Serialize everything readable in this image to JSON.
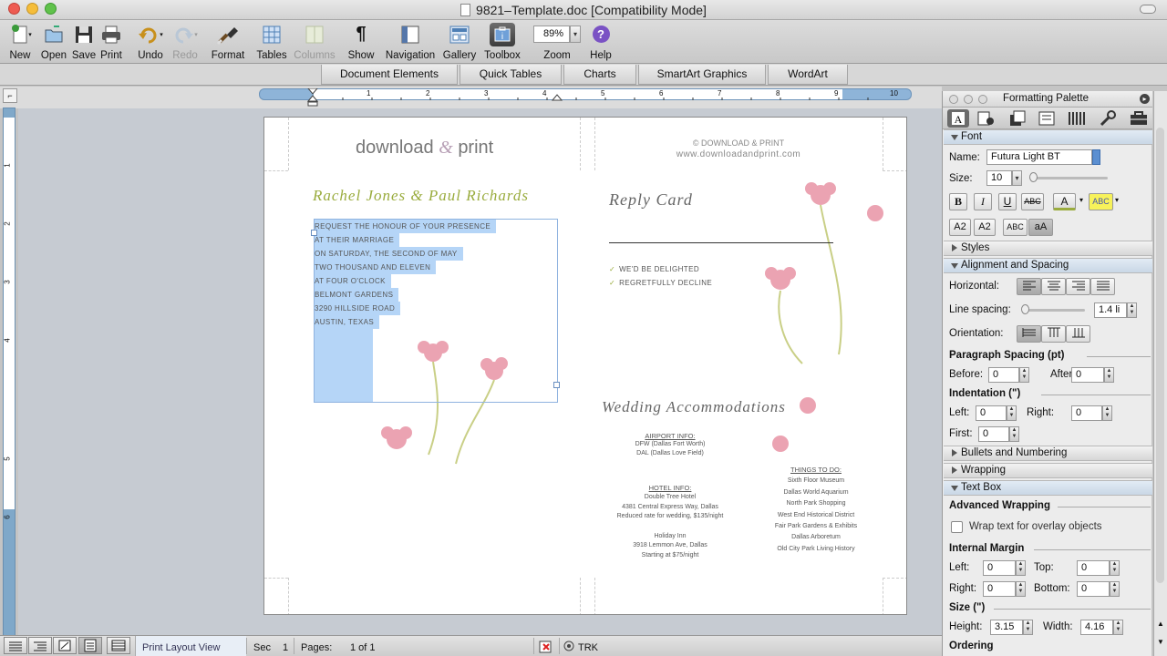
{
  "window": {
    "title": "9821–Template.doc [Compatibility Mode]"
  },
  "toolbar": {
    "items": [
      {
        "label": "New",
        "icon": "new-doc-icon"
      },
      {
        "label": "Open",
        "icon": "open-folder-icon"
      },
      {
        "label": "Save",
        "icon": "save-disk-icon"
      },
      {
        "label": "Print",
        "icon": "printer-icon"
      },
      {
        "label": "Undo",
        "icon": "undo-icon"
      },
      {
        "label": "Redo",
        "icon": "redo-icon"
      },
      {
        "label": "Format",
        "icon": "format-brush-icon"
      },
      {
        "label": "Tables",
        "icon": "table-icon"
      },
      {
        "label": "Columns",
        "icon": "columns-icon"
      },
      {
        "label": "Show",
        "icon": "pilcrow-icon"
      },
      {
        "label": "Navigation",
        "icon": "navigation-pane-icon"
      },
      {
        "label": "Gallery",
        "icon": "gallery-icon"
      },
      {
        "label": "Toolbox",
        "icon": "toolbox-icon"
      },
      {
        "label": "Zoom",
        "icon": "zoom-icon"
      },
      {
        "label": "Help",
        "icon": "help-icon"
      }
    ],
    "zoom_value": "89%",
    "show_glyph": "¶",
    "help_glyph": "?"
  },
  "ribbon": {
    "tabs": [
      "Document Elements",
      "Quick Tables",
      "Charts",
      "SmartArt Graphics",
      "WordArt"
    ]
  },
  "ruler": {
    "numbers": [
      "1",
      "2",
      "3",
      "4",
      "5",
      "6",
      "7",
      "8",
      "9",
      "10"
    ]
  },
  "vruler": {
    "numbers": [
      "1",
      "2",
      "3",
      "4",
      "5",
      "6"
    ]
  },
  "document": {
    "brand_left": "download",
    "brand_amp": "&",
    "brand_right": "print",
    "copyright": "© DOWNLOAD & PRINT",
    "website": "www.downloadandprint.com",
    "names": "Rachel Jones & Paul Richards",
    "invite_lines": [
      "REQUEST THE HONOUR OF YOUR PRESENCE",
      "AT THEIR MARRIAGE",
      "ON SATURDAY, THE SECOND OF MAY",
      "TWO THOUSAND AND ELEVEN",
      "AT FOUR O'CLOCK",
      "BELMONT GARDENS",
      "3290 HILLSIDE ROAD",
      "AUSTIN, TEXAS"
    ],
    "reply_title": "Reply Card",
    "reply_options": [
      "WE'D BE DELIGHTED",
      "REGRETFULLY DECLINE"
    ],
    "accom_title": "Wedding Accommodations",
    "airport_heading": "AIRPORT INFO:",
    "airport_lines": [
      "DFW (Dallas Fort Worth)",
      "DAL (Dallas Love Field)"
    ],
    "hotel_heading": "HOTEL INFO:",
    "hotel_lines": [
      "Double Tree Hotel",
      "4381 Central Express Way, Dallas",
      "Reduced rate for wedding, $135/night",
      "",
      "Holiday Inn",
      "3918 Lemmon Ave, Dallas",
      "Starting at $75/night"
    ],
    "things_heading": "THINGS TO DO:",
    "things_lines": [
      "Sixth Floor Museum",
      "Dallas World Aquarium",
      "North Park Shopping",
      "West End Historical District",
      "Fair Park Gardens & Exhibits",
      "Dallas Arboretum",
      "Old City Park Living History"
    ]
  },
  "palette": {
    "title": "Formatting Palette",
    "sections": {
      "font": "Font",
      "styles": "Styles",
      "alignment": "Alignment and Spacing",
      "bullets": "Bullets and Numbering",
      "wrapping": "Wrapping",
      "textbox": "Text Box"
    },
    "font": {
      "name_label": "Name:",
      "name_value": "Futura Light BT",
      "size_label": "Size:",
      "size_value": "10",
      "bold": "B",
      "italic": "I",
      "underline": "U",
      "strike": "ABC",
      "color_a": "A",
      "highlight": "ABC",
      "superscript": "A2",
      "subscript": "A2",
      "smallcaps": "ABC",
      "allcaps": "aA"
    },
    "alignment": {
      "horizontal_label": "Horizontal:",
      "line_spacing_label": "Line spacing:",
      "line_spacing_value": "1.4 li",
      "orientation_label": "Orientation:",
      "paragraph_spacing_label": "Paragraph Spacing (pt)",
      "before_label": "Before:",
      "before_value": "0",
      "after_label": "After:",
      "after_value": "0",
      "indentation_label": "Indentation (\")",
      "left_label": "Left:",
      "left_value": "0",
      "right_label": "Right:",
      "right_value": "0",
      "first_label": "First:",
      "first_value": "0"
    },
    "textbox": {
      "advanced_wrapping_label": "Advanced Wrapping",
      "wrap_checkbox_label": "Wrap text for overlay objects",
      "internal_margin_label": "Internal Margin",
      "left_label": "Left:",
      "left_value": "0",
      "top_label": "Top:",
      "top_value": "0",
      "right_label": "Right:",
      "right_value": "0",
      "bottom_label": "Bottom:",
      "bottom_value": "0",
      "size_label": "Size (\")",
      "height_label": "Height:",
      "height_value": "3.15",
      "width_label": "Width:",
      "width_value": "4.16",
      "ordering_label": "Ordering"
    }
  },
  "status": {
    "view": "Print Layout View",
    "sec_label": "Sec",
    "sec_value": "1",
    "pages_label": "Pages:",
    "pages_value": "1 of 1",
    "trk": "TRK"
  },
  "colors": {
    "accent_green": "#9aac3e",
    "selection": "#b5d5f7",
    "flower_pink": "#eba3b2",
    "leaf_green": "#d7dc9e"
  }
}
